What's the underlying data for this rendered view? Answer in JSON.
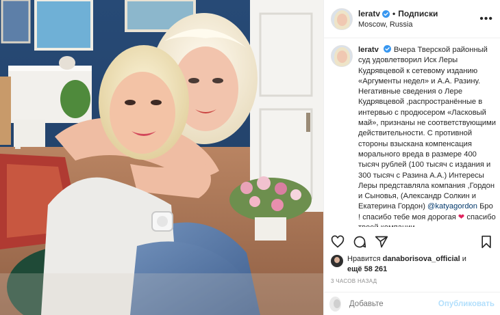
{
  "post": {
    "username": "leratv",
    "follow_label": "Подписки",
    "location": "Moscow, Russia",
    "caption_username": "leratv",
    "caption_body": "Вчера Тверской районный суд удовлетворил Иск Леры Кудрявцевой к сетевому изданию «Аргументы недел» и А.А. Разину. Негативные сведения о Лере Кудрявцевой ,распространённые в интервью с продюсером «Ласковый май», признаны не соответствующими действительности. С противной стороны взыскана компенсация морального вреда в размере 400 тысяч рублей (100 тысяч с издания и 300 тысяч с Разина А.А.) Интересы Леры представляла компания ,Гордон и Сыновья, (Александр Солкин и Екатерина Гордон)",
    "caption_mention": "@katyagordon",
    "caption_tail": " Бро ! спасибо тебе моя дорогая ",
    "caption_heart": "❤",
    "caption_end": " спасибо твоей компании",
    "liked_by_prefix": "Нравится",
    "liked_by_user": "danaborisova_official",
    "liked_by_and": "и",
    "liked_by_others": "ещё 58 261",
    "timestamp": "3 ЧАСОВ НАЗАД",
    "comment_placeholder": "Добавьте",
    "publish_label": "Опубликовать"
  },
  "icons": [
    "verified-badge-icon",
    "more-options-icon",
    "heart-icon",
    "comment-icon",
    "share-icon",
    "bookmark-icon",
    "emoji-icon"
  ],
  "colors": {
    "text": "#262626",
    "muted": "#8e8e8e",
    "mention": "#00376b",
    "publish_disabled": "#b2dffc",
    "verified": "#3897f0"
  }
}
